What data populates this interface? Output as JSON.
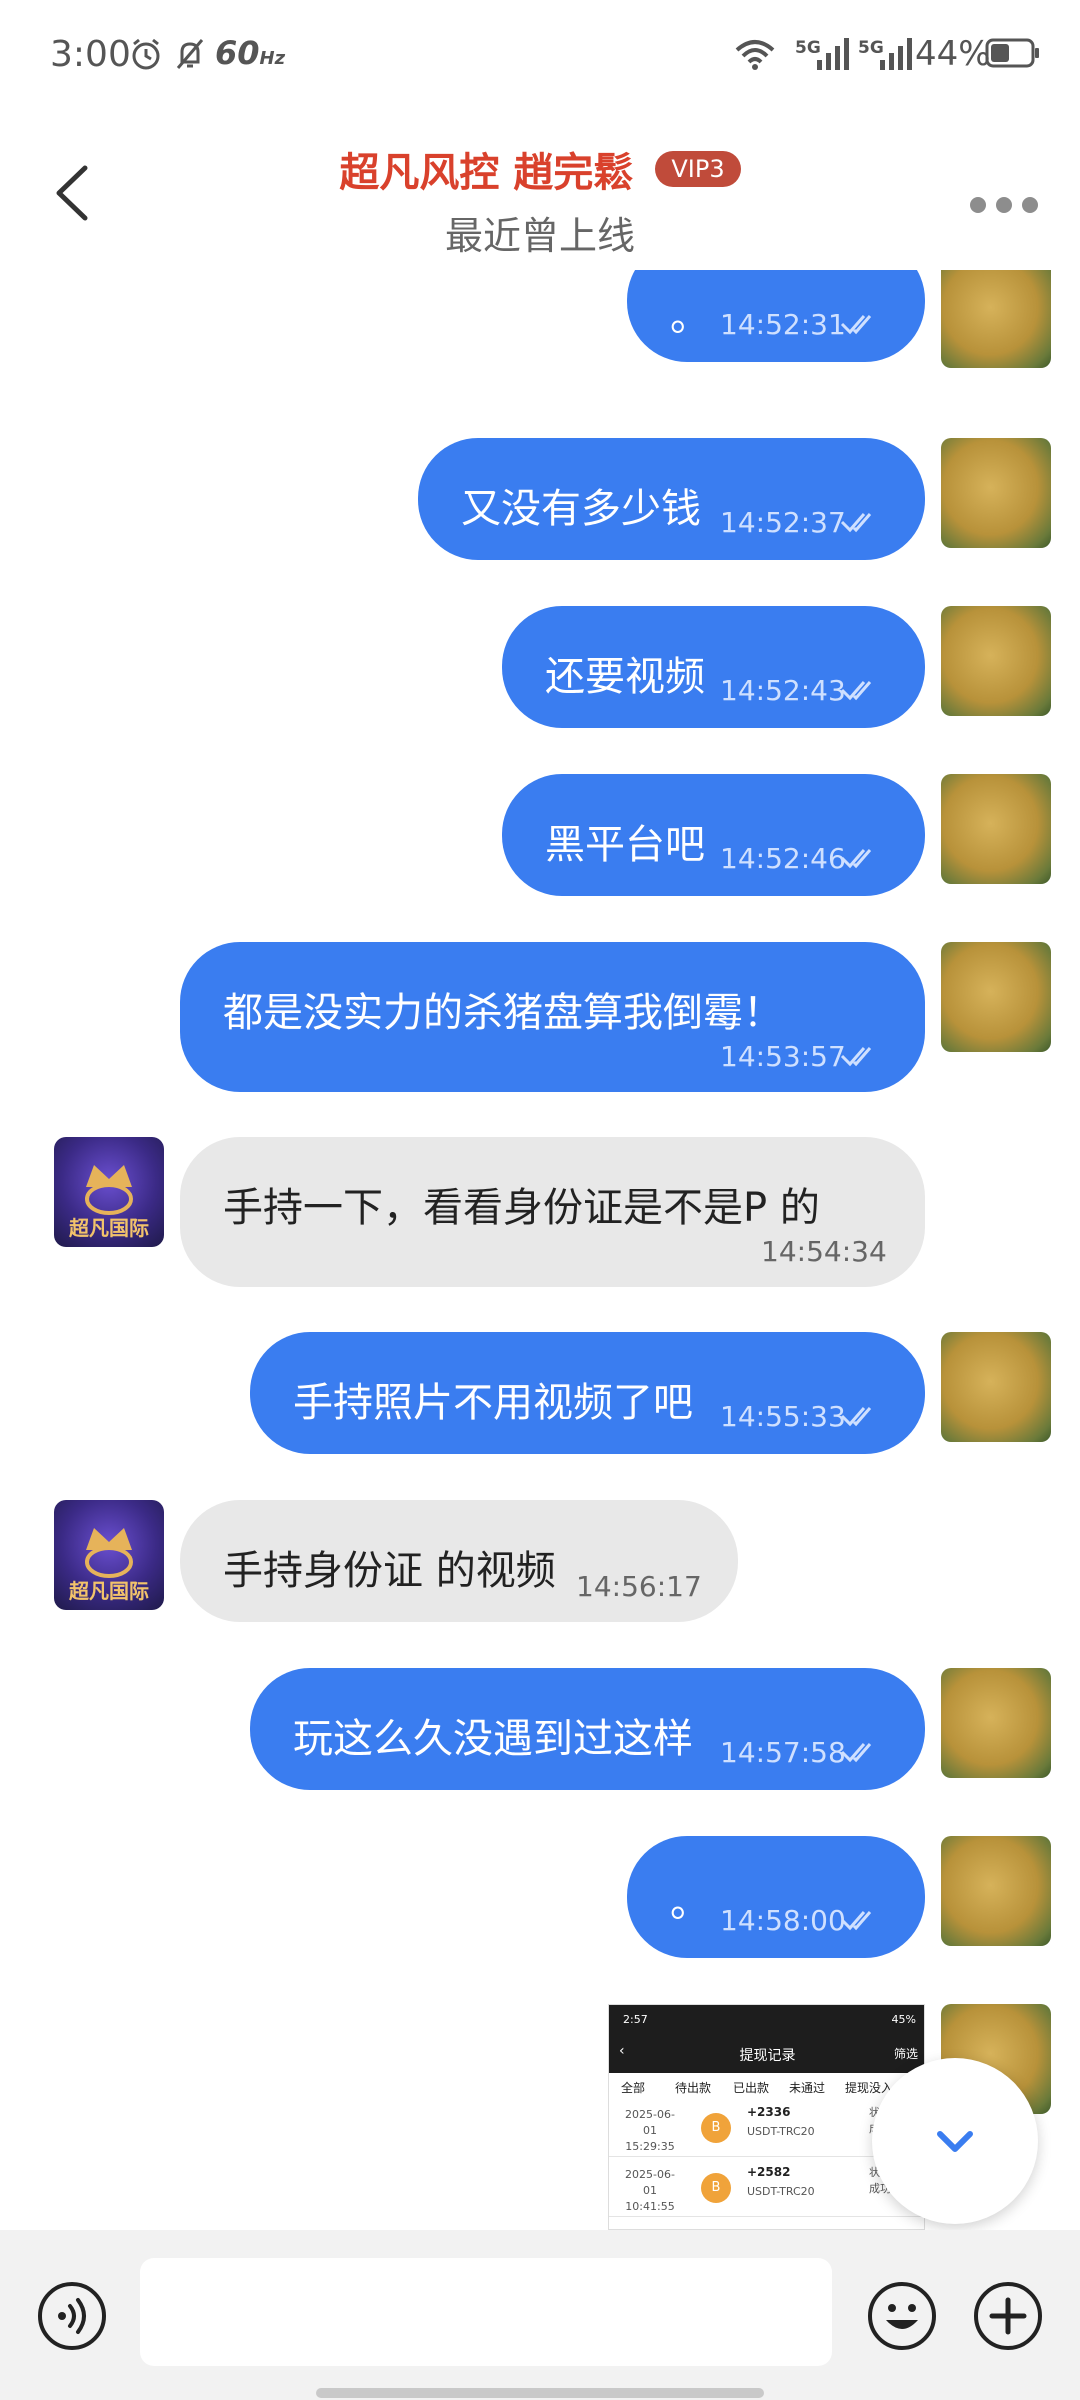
{
  "status_bar": {
    "time": "3:00",
    "refresh_rate": "60",
    "refresh_unit": "Hz",
    "battery": "44%",
    "network1": "5G",
    "network2": "5G"
  },
  "header": {
    "title": "超凡风控 趙完鬆",
    "vip": "VIP3",
    "subtitle": "最近曾上线"
  },
  "messages": [
    {
      "dir": "out",
      "text": "。",
      "time": "14:52:31"
    },
    {
      "dir": "out",
      "text": "又没有多少钱",
      "time": "14:52:37"
    },
    {
      "dir": "out",
      "text": "还要视频",
      "time": "14:52:43"
    },
    {
      "dir": "out",
      "text": "黑平台吧",
      "time": "14:52:46"
    },
    {
      "dir": "out",
      "text": "都是没实力的杀猪盘算我倒霉！",
      "time": "14:53:57"
    },
    {
      "dir": "in",
      "text": "手持一下，看看身份证是不是P 的",
      "time": "14:54:34"
    },
    {
      "dir": "out",
      "text": "手持照片不用视频了吧",
      "time": "14:55:33"
    },
    {
      "dir": "in",
      "text": "手持身份证 的视频",
      "time": "14:56:17"
    },
    {
      "dir": "out",
      "text": "玩这么久没遇到过这样",
      "time": "14:57:58"
    },
    {
      "dir": "out",
      "text": "。",
      "time": "14:58:00"
    }
  ],
  "avatar_them_label": "超凡国际",
  "screenshot_preview": {
    "time": "2:57",
    "status": "45%",
    "title": "提现记录",
    "filter": "筛选",
    "tabs": [
      "全部",
      "待出款",
      "已出款",
      "未通过",
      "提现没入"
    ],
    "rows": [
      {
        "date": "2025-06-01",
        "clock": "15:29:35",
        "amount": "+2336",
        "currency": "USDT-TRC20",
        "state": "状态",
        "result": "成"
      },
      {
        "date": "2025-06-01",
        "clock": "10:41:55",
        "amount": "+2582",
        "currency": "USDT-TRC20",
        "state": "状态：",
        "result": "成功"
      }
    ],
    "coin_label": "B"
  },
  "input": {
    "placeholder": ""
  },
  "icons": {
    "back": "chevron-left-icon",
    "more": "more-dots-icon",
    "voice": "voice-icon",
    "emoji": "emoji-icon",
    "plus": "plus-icon",
    "scroll_down": "chevron-down-icon",
    "read": "double-check-icon"
  },
  "colors": {
    "accent": "#3a7df0",
    "title": "#d9412c",
    "vip": "#c04b3a",
    "incoming_bubble": "#e8e8e8"
  }
}
